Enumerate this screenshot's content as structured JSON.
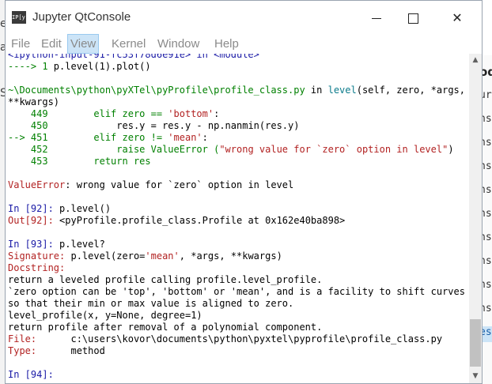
{
  "window": {
    "title": "Jupyter QtConsole",
    "icon_text": "IP[y]",
    "controls": {
      "minimize": "minimize",
      "maximize": "maximize",
      "close": "✕"
    }
  },
  "menubar": {
    "items": [
      "File",
      "Edit",
      "View",
      "Kernel",
      "Window",
      "Help"
    ],
    "active": "View"
  },
  "background_window": {
    "top_text": "od",
    "rows": [
      "ur",
      "hs",
      "hs",
      "hs",
      "hs",
      "hs",
      "hs",
      "hs",
      "hs",
      "hs",
      "es"
    ],
    "left_edge_chars": [
      "e",
      "a",
      "S"
    ]
  },
  "console": {
    "l0": "<ipython-input-91-fc53f78d6e91e> in <module>",
    "l1_arrow": "----> 1 ",
    "l1_code": "p.level(1).plot()",
    "l2": "",
    "l3_path": "~\\Documents\\python\\pyXTel\\pyProfile\\profile_class.py",
    "l3_in": " in ",
    "l3_func": "level",
    "l3_args": "(self, zero, *args,",
    "l4": "**kwargs)",
    "l5_num": "    449",
    "l5_code": "        elif zero == ",
    "l5_str": "'bottom'",
    "l5_end": ":",
    "l6_num": "    450",
    "l6_code": "            res.y = res.y - np.nanmin(res.y)",
    "l7_num": "--> 451",
    "l7_code": "        elif zero != ",
    "l7_str": "'mean'",
    "l7_end": ":",
    "l8_num": "    452",
    "l8_code": "            raise ValueError (",
    "l8_str": "\"wrong value for `zero` option in level\"",
    "l8_end": ")",
    "l9_num": "    453",
    "l9_code": "        return res",
    "l10": "",
    "l11_err": "ValueError",
    "l11_msg": ": wrong value for `zero` option in level",
    "l12": "",
    "l13_prompt": "In [92]: ",
    "l13_code": "p.level()",
    "l14_prompt": "Out[92]: ",
    "l14_code": "<pyProfile.profile_class.Profile at 0x162e40ba898>",
    "l15": "",
    "l16_prompt": "In [93]: ",
    "l16_code": "p.level?",
    "l17_label": "Signature:",
    "l17_code": " p.level(zero=",
    "l17_str": "'mean'",
    "l17_end": ", *args, **kwargs)",
    "l18": "Docstring:",
    "l19": "return a leveled profile calling profile.level_profile.",
    "l20": "`zero option can be 'top', 'bottom' or 'mean', and is a facility to shift curves",
    "l21": "so that their min or max value is aligned to zero.",
    "l22": "level_profile(x, y=None, degree=1)",
    "l23": "return profile after removal of a polynomial component.",
    "l24_label": "File:",
    "l24_value": "      c:\\users\\kovor\\documents\\python\\pyxtel\\pyprofile\\profile_class.py",
    "l25_label": "Type:",
    "l25_value": "      method",
    "l26": "",
    "l27_prompt": "In [94]:",
    "l27_value": ""
  },
  "scrollbar": {
    "up": "▲",
    "down": "▼"
  }
}
